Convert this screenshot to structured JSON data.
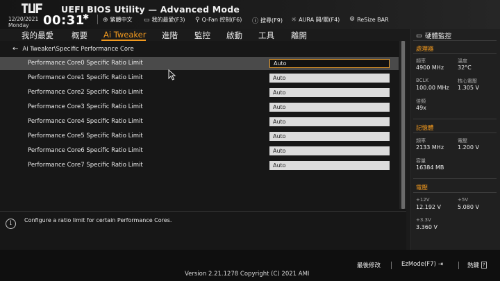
{
  "header": {
    "title": "UEFI BIOS Utility — Advanced Mode",
    "date": "12/20/2021",
    "day": "Monday",
    "time": "00:31",
    "tools": [
      {
        "label": "繁體中文",
        "icon": "globe-icon"
      },
      {
        "label": "我的最愛(F3)",
        "icon": "favorites-icon"
      },
      {
        "label": "Q-Fan 控制(F6)",
        "icon": "fan-icon"
      },
      {
        "label": "搜尋(F9)",
        "icon": "search-help-icon"
      },
      {
        "label": "AURA 開/關(F4)",
        "icon": "aura-icon"
      },
      {
        "label": "ReSize BAR",
        "icon": "resize-bar-icon"
      }
    ]
  },
  "menu": {
    "items": [
      "我的最愛",
      "概要",
      "Ai Tweaker",
      "進階",
      "監控",
      "啟動",
      "工具",
      "離開"
    ],
    "active": "Ai Tweaker"
  },
  "breadcrumb": "Ai Tweaker\\Specific Performance Core",
  "settings": [
    {
      "label": "Performance Core0 Specific Ratio Limit",
      "value": "Auto",
      "selected": true
    },
    {
      "label": "Performance Core1 Specific  Ratio Limit",
      "value": "Auto"
    },
    {
      "label": "Performance Core2 Specific  Ratio Limit",
      "value": "Auto"
    },
    {
      "label": "Performance Core3 Specific  Ratio Limit",
      "value": "Auto"
    },
    {
      "label": "Performance Core4 Specific  Ratio Limit",
      "value": "Auto"
    },
    {
      "label": "Performance Core5 Specific  Ratio Limit",
      "value": "Auto"
    },
    {
      "label": "Performance Core6 Specific  Ratio Limit",
      "value": "Auto"
    },
    {
      "label": "Performance Core7 Specific  Ratio Limit",
      "value": "Auto"
    }
  ],
  "help_text": "Configure a ratio limit for certain Performance Cores.",
  "monitor": {
    "title": "硬體監控",
    "cpu": {
      "section": "處理器",
      "freq_label": "頻率",
      "freq": "4900 MHz",
      "temp_label": "溫度",
      "temp": "32°C",
      "bclk_label": "BCLK",
      "bclk": "100.00 MHz",
      "vcore_label": "核心電壓",
      "vcore": "1.305 V",
      "ratio_label": "倍頻",
      "ratio": "49x"
    },
    "memory": {
      "section": "記憶體",
      "freq_label": "頻率",
      "freq": "2133 MHz",
      "volt_label": "電壓",
      "volt": "1.200 V",
      "cap_label": "容量",
      "cap": "16384 MB"
    },
    "voltage": {
      "section": "電壓",
      "v12_label": "+12V",
      "v12": "12.192 V",
      "v5_label": "+5V",
      "v5": "5.080 V",
      "v33_label": "+3.3V",
      "v33": "3.360 V"
    }
  },
  "footer": {
    "version": "Version 2.21.1278 Copyright (C) 2021 AMI",
    "last_modified": "最後修改",
    "ezmode": "EzMode(F7)",
    "hotkeys": "熱鍵",
    "hotkeys_key": "?"
  },
  "colors": {
    "accent": "#f39a1e",
    "background": "#1b1b1b",
    "selected_row": "#4a4a4a"
  }
}
